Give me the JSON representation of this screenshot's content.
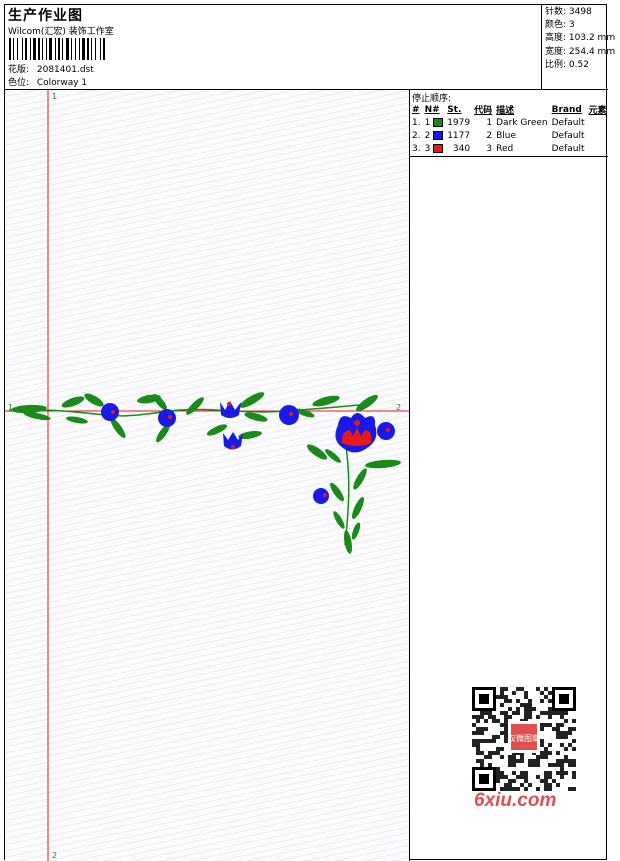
{
  "header": {
    "title": "生产作业图",
    "studio": "Wilcom(汇宏) 装饰工作室",
    "design_label": "花版:",
    "design_value": "2081401.dst",
    "color_label": "色位:",
    "color_value": "Colorway 1"
  },
  "stats": [
    {
      "label": "针数:",
      "value": "3498"
    },
    {
      "label": "颜色:",
      "value": "3"
    },
    {
      "label": "高度:",
      "value": "103.2 mm"
    },
    {
      "label": "宽度:",
      "value": "254.4 mm"
    },
    {
      "label": "比例:",
      "value": "0.52"
    }
  ],
  "stop_sequence": {
    "title": "停止顺序:",
    "headers": [
      "#",
      "N#",
      "St.",
      "代码",
      "描述",
      "Brand",
      "元素"
    ],
    "rows": [
      {
        "num": "1.",
        "n": "1",
        "stitches": "1979",
        "code": "1",
        "desc": "Dark Green",
        "brand": "Default",
        "swatch": "#1a8a1a"
      },
      {
        "num": "2.",
        "n": "2",
        "stitches": "1177",
        "code": "2",
        "desc": "Blue",
        "brand": "Default",
        "swatch": "#1a1ae6"
      },
      {
        "num": "3.",
        "n": "3",
        "stitches": "340",
        "code": "3",
        "desc": "Red",
        "brand": "Default",
        "swatch": "#e61a1a"
      }
    ]
  },
  "axes": {
    "v_top": "1",
    "v_bottom": "2",
    "h_left": "1",
    "h_right": "2",
    "axis_color": "#e61a1a"
  },
  "watermark": {
    "text": "6xiu.com",
    "stamp": "汉微图章",
    "color": "#e05050"
  }
}
